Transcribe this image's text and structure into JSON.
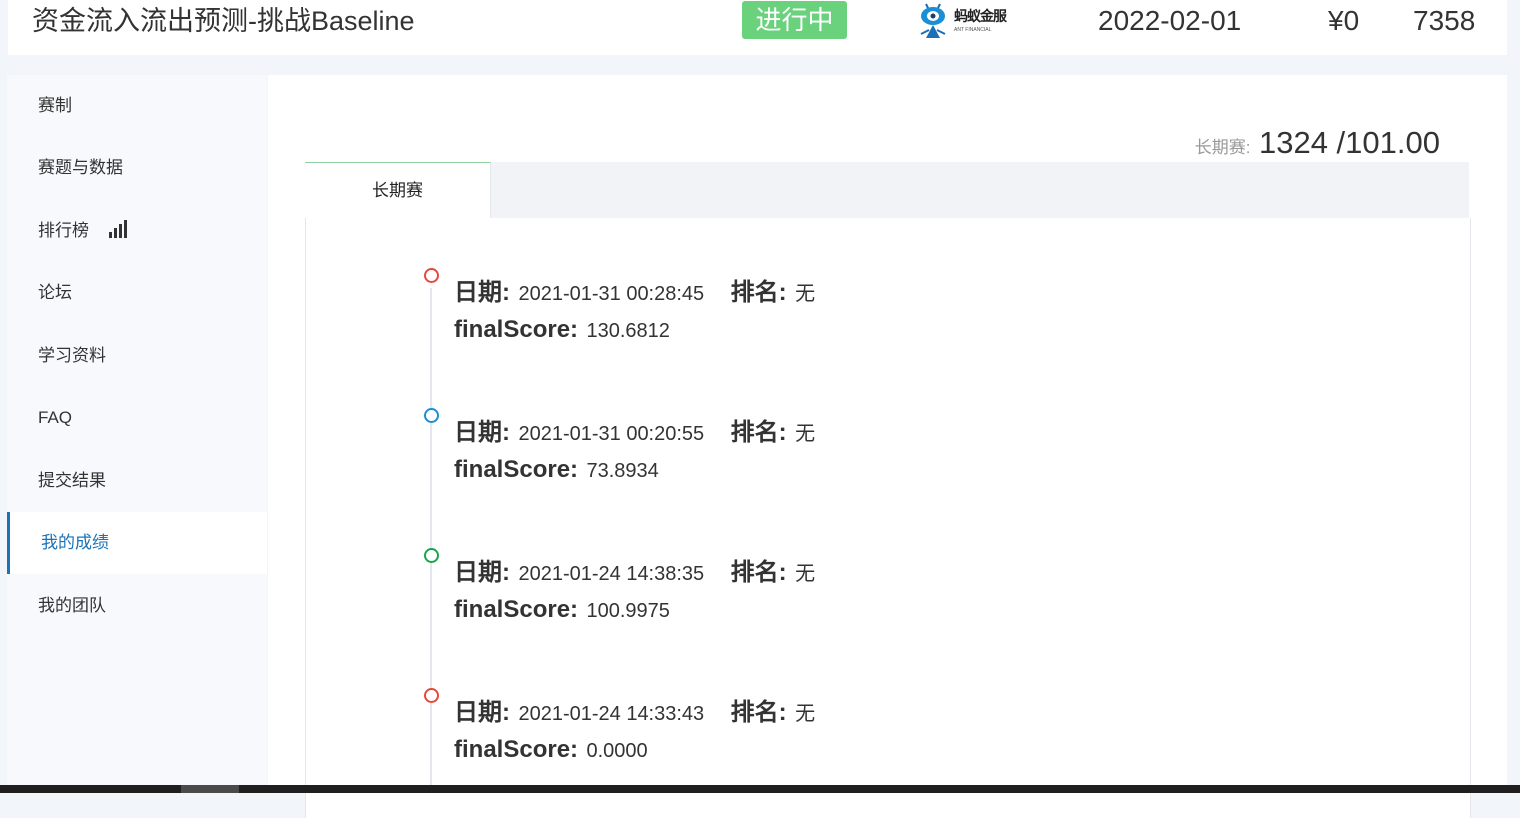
{
  "header": {
    "title": "资金流入流出预测-挑战Baseline",
    "status": "进行中",
    "sponsor": {
      "name": "蚂蚁金服",
      "sub": "ANT FINANCIAL"
    },
    "date": "2022-02-01",
    "prize": "¥0",
    "teams": "7358"
  },
  "sidebar": {
    "items": [
      {
        "label": "赛制"
      },
      {
        "label": "赛题与数据"
      },
      {
        "label": "排行榜",
        "icon": "bar-chart-icon"
      },
      {
        "label": "论坛"
      },
      {
        "label": "学习资料"
      },
      {
        "label": "FAQ"
      },
      {
        "label": "提交结果"
      },
      {
        "label": "我的成绩",
        "active": true
      },
      {
        "label": "我的团队"
      }
    ]
  },
  "main": {
    "score_summary": {
      "label": "长期赛:",
      "value": "1324 /101.00"
    },
    "tabs": [
      {
        "label": "长期赛",
        "active": true
      }
    ],
    "record_labels": {
      "date": "日期:",
      "rank": "排名:",
      "score": "finalScore:"
    },
    "records": [
      {
        "date": "2021-01-31 00:28:45",
        "rank": "无",
        "score": "130.6812",
        "dot_color": "#e04b3c"
      },
      {
        "date": "2021-01-31 00:20:55",
        "rank": "无",
        "score": "73.8934",
        "dot_color": "#1a8fd6"
      },
      {
        "date": "2021-01-24 14:38:35",
        "rank": "无",
        "score": "100.9975",
        "dot_color": "#1aa34a"
      },
      {
        "date": "2021-01-24 14:33:43",
        "rank": "无",
        "score": "0.0000",
        "dot_color": "#e04b3c"
      }
    ]
  },
  "colors": {
    "accent": "#1a73b8",
    "status_badge": "#6ad17d",
    "background": "#f2f5f9"
  }
}
